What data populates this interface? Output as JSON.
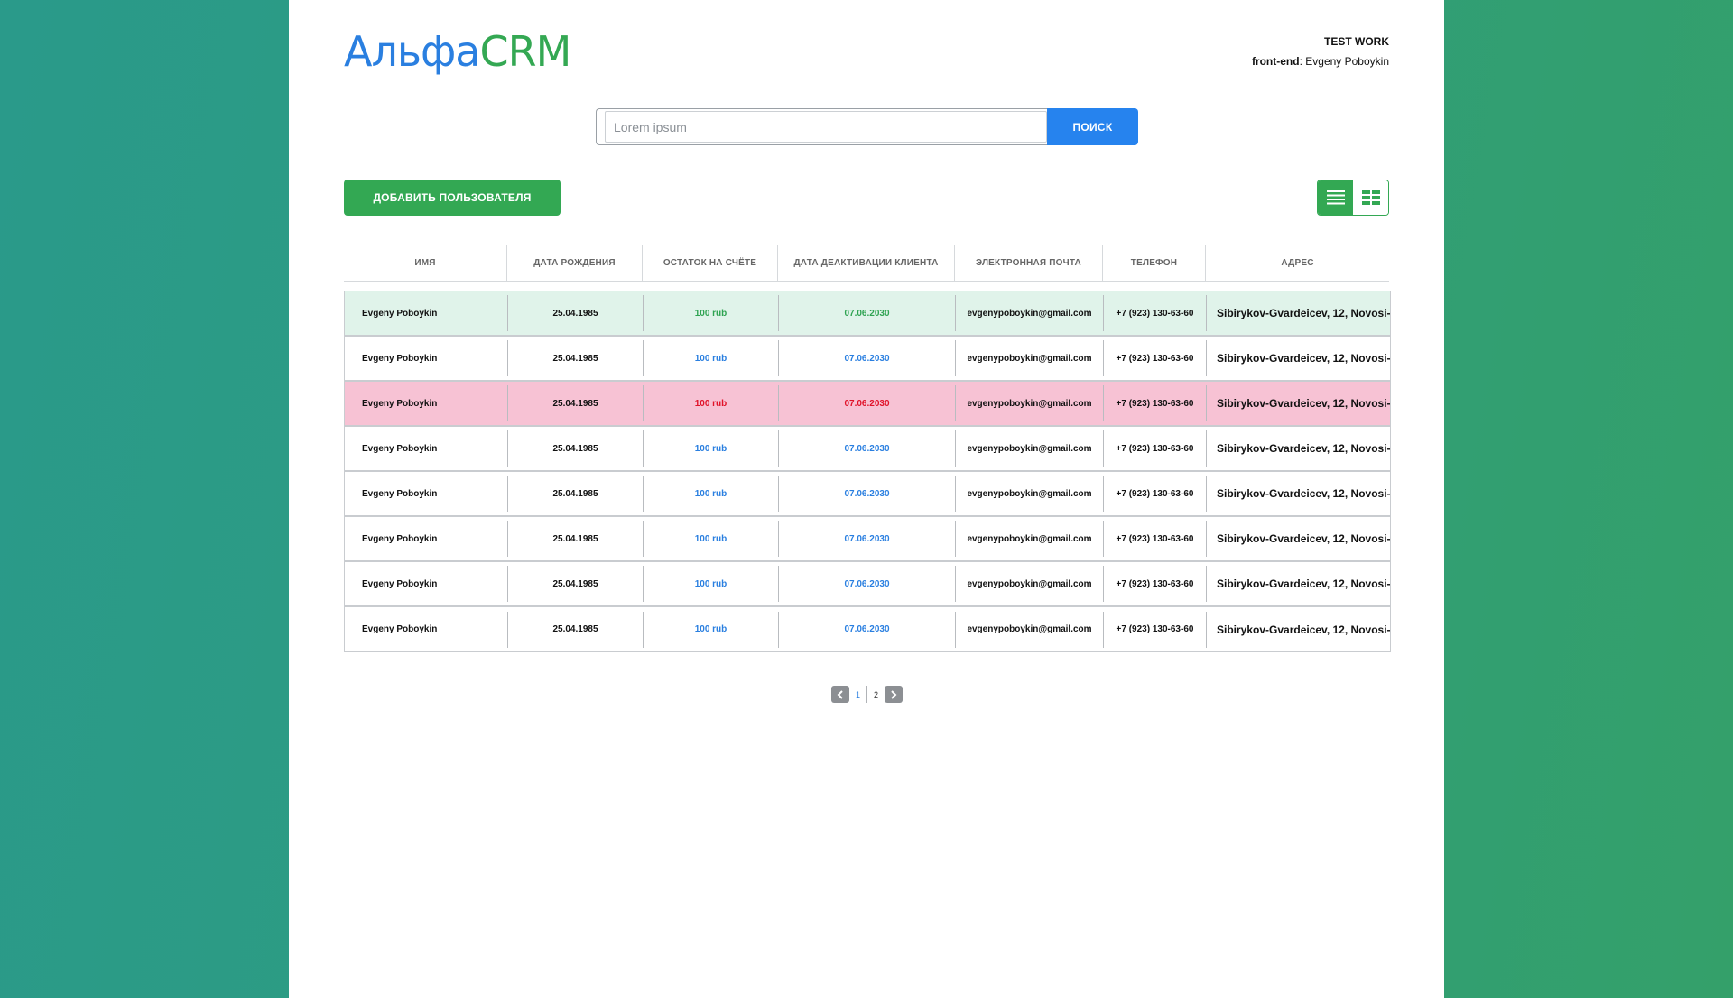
{
  "header": {
    "logo_part1": "Альфа",
    "logo_part2": "CRM",
    "title": "TEST WORK",
    "role": "front-end",
    "author": "Evgeny Poboykin"
  },
  "search": {
    "placeholder": "Lorem ipsum",
    "button_label": "ПОИСК"
  },
  "toolbar": {
    "add_user_label": "ДОБАВИТЬ ПОЛЬЗОВАТЕЛЯ",
    "view_list_icon": "list-icon",
    "view_grid_icon": "grid-icon"
  },
  "table": {
    "columns": [
      "ИМЯ",
      "ДАТА РОЖДЕНИЯ",
      "ОСТАТОК НА СЧЁТЕ",
      "ДАТА ДЕАКТИВАЦИИ КЛИЕНТА",
      "ЭЛЕКТРОННАЯ ПОЧТА",
      "ТЕЛЕФОН",
      "АДРЕС"
    ],
    "rows": [
      {
        "status": "green",
        "name": "Evgeny Poboykin",
        "birth": "25.04.1985",
        "balance": "100 rub",
        "deactivation": "07.06.2030",
        "email": "evgenypoboykin@gmail.com",
        "phone": "+7 (923) 130-63-60",
        "address": "Sibirykov-Gvardeicev, 12, Novosi-"
      },
      {
        "status": "normal",
        "name": "Evgeny Poboykin",
        "birth": "25.04.1985",
        "balance": "100 rub",
        "deactivation": "07.06.2030",
        "email": "evgenypoboykin@gmail.com",
        "phone": "+7 (923) 130-63-60",
        "address": "Sibirykov-Gvardeicev, 12, Novosi-"
      },
      {
        "status": "red",
        "name": "Evgeny Poboykin",
        "birth": "25.04.1985",
        "balance": "100 rub",
        "deactivation": "07.06.2030",
        "email": "evgenypoboykin@gmail.com",
        "phone": "+7 (923) 130-63-60",
        "address": "Sibirykov-Gvardeicev, 12, Novosi-"
      },
      {
        "status": "normal",
        "name": "Evgeny Poboykin",
        "birth": "25.04.1985",
        "balance": "100 rub",
        "deactivation": "07.06.2030",
        "email": "evgenypoboykin@gmail.com",
        "phone": "+7 (923) 130-63-60",
        "address": "Sibirykov-Gvardeicev, 12, Novosi-"
      },
      {
        "status": "normal",
        "name": "Evgeny Poboykin",
        "birth": "25.04.1985",
        "balance": "100 rub",
        "deactivation": "07.06.2030",
        "email": "evgenypoboykin@gmail.com",
        "phone": "+7 (923) 130-63-60",
        "address": "Sibirykov-Gvardeicev, 12, Novosi-"
      },
      {
        "status": "normal",
        "name": "Evgeny Poboykin",
        "birth": "25.04.1985",
        "balance": "100 rub",
        "deactivation": "07.06.2030",
        "email": "evgenypoboykin@gmail.com",
        "phone": "+7 (923) 130-63-60",
        "address": "Sibirykov-Gvardeicev, 12, Novosi-"
      },
      {
        "status": "normal",
        "name": "Evgeny Poboykin",
        "birth": "25.04.1985",
        "balance": "100 rub",
        "deactivation": "07.06.2030",
        "email": "evgenypoboykin@gmail.com",
        "phone": "+7 (923) 130-63-60",
        "address": "Sibirykov-Gvardeicev, 12, Novosi-"
      },
      {
        "status": "normal",
        "name": "Evgeny Poboykin",
        "birth": "25.04.1985",
        "balance": "100 rub",
        "deactivation": "07.06.2030",
        "email": "evgenypoboykin@gmail.com",
        "phone": "+7 (923) 130-63-60",
        "address": "Sibirykov-Gvardeicev, 12, Novosi-"
      }
    ]
  },
  "pagination": {
    "pages": [
      "1",
      "2"
    ],
    "current": "1",
    "prev_icon": "chevron-left-icon",
    "next_icon": "chevron-right-icon"
  },
  "colors": {
    "brand_blue": "#2a7fe0",
    "brand_green": "#33a853",
    "row_active": "#e0f3ea",
    "row_deactivated": "#f7c2d4",
    "text_red": "#e0132a"
  }
}
